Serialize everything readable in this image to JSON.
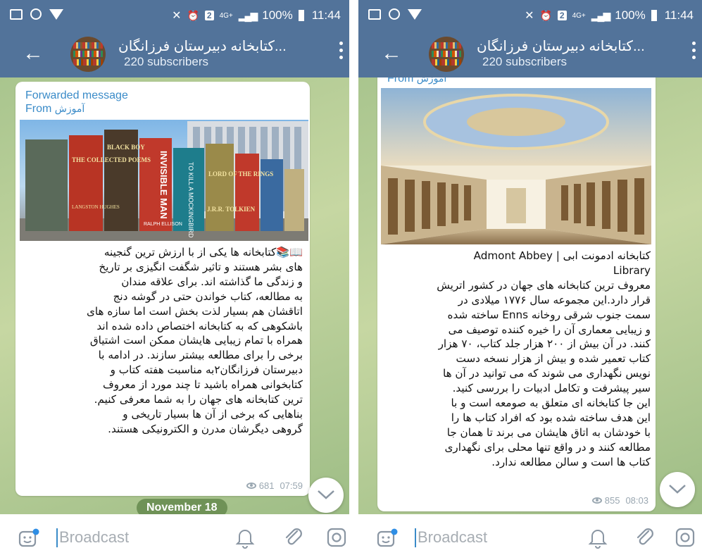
{
  "status_bar": {
    "network": "4G+",
    "sim": "2",
    "battery": "100%",
    "time": "11:44"
  },
  "left": {
    "channel_title": "کتابخانه دبیرستان فرزانگان...",
    "subscribers": "220 subscribers",
    "forwarded_label": "Forwarded message",
    "forwarded_from_word": "From",
    "forwarded_from_name": "آموزش",
    "photo_books": [
      "BLACK BOY",
      "THE COLLECTED POEMS",
      "INVISIBLE MAN",
      "TO KILL A MOCKINGBIRD",
      "LORD OF THE RINGS",
      "J.R.R. TOLKIEN",
      "RALPH ELLISON",
      "LANGSTON HUGHES"
    ],
    "message_text": "📖📚کتابخانه ها یکی از با ارزش ترین گنجینه\nهای بشر هستند و تاثیر شگفت انگیزی بر تاریخ\nو زندگی ما گذاشته اند. برای علاقه مندان\nبه مطالعه، کتاب خواندن حتی در گوشه دنج\nاتاقشان هم بسیار لذت بخش است اما سازه های\nباشکوهی که به کتابخانه اختصاص داده شده اند\nهمراه با تمام زیبایی هایشان ممکن است اشتیاق\nبرخی را برای مطالعه بیشتر سازند. در ادامه با\nدبیرستان فرزانگان۲به مناسبت هفته کتاب و\nکتابخوانی همراه باشید تا چند مورد از معروف\nترین کتابخانه های جهان را به شما معرفی کنیم.\nبناهایی که برخی از آن ها بسیار تاریخی و\nگروهی دیگرشان مدرن و الکترونیکی هستند.",
    "views": "681",
    "time": "07:59",
    "date_chip": "November 18",
    "input_placeholder": "Broadcast"
  },
  "right": {
    "channel_title": "کتابخانه دبیرستان فرزانگان...",
    "subscribers": "220 subscribers",
    "forwarded_from_word": "From",
    "forwarded_from_name": "آموزش",
    "message_text": "کتابخانه ادمونت ابی | Admont Abbey\nLibrary\nمعروف ترین کتابخانه های جهان در کشور اتریش\nقرار دارد.این مجموعه سال ۱۷۷۶ میلادی در\nسمت جنوب شرقی روخانه Enns ساخته شده\nو زیبایی معماری آن را خیره کننده توصیف می\nکنند. در آن بیش از ۲۰۰ هزار جلد کتاب، ۷۰ هزار\nکتاب تعمیر شده و بیش از هزار نسخه دست\nنویس نگهداری می شوند که می توانید در آن ها\nسیر پیشرفت و تکامل ادبیات را بررسی کنید.\nاین جا کتابخانه ای متعلق به صومعه است و با\nاین هدف ساخته شده بود که افراد کتاب ها را\nبا خودشان به اتاق هایشان می برند تا همان جا\nمطالعه کنند و در واقع تنها محلی برای نگهداری\nکتاب ها است و سالن مطالعه ندارد.",
    "views": "855",
    "time": "08:03",
    "input_placeholder": "Broadcast"
  },
  "colors": {
    "header": "#52739a",
    "link": "#3a8bc8",
    "chat_bg": "#b8d095",
    "date_chip": "#6f9257"
  },
  "icons": [
    "back-arrow-icon",
    "menu-dots-icon",
    "sticker-icon",
    "bell-icon",
    "paperclip-icon",
    "camera-icon",
    "chevron-down-icon",
    "eye-icon"
  ]
}
